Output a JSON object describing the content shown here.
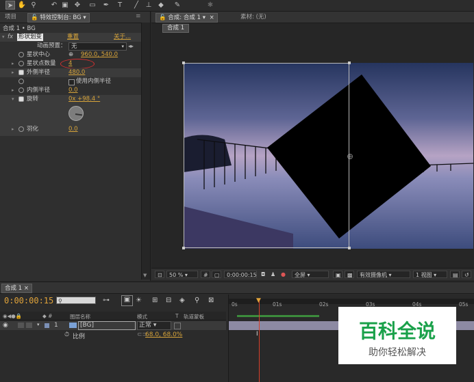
{
  "toolbar": {
    "tools": [
      "selection-tool",
      "hand-tool",
      "zoom-tool",
      "rotate-tool",
      "camera-tool",
      "pan-behind-tool",
      "rectangle-tool",
      "pen-tool",
      "text-tool",
      "brush-tool",
      "clone-stamp-tool",
      "eraser-tool",
      "roto-brush-tool",
      "puppet-tool"
    ]
  },
  "left_panel": {
    "tabs": [
      "项目",
      "特效控制台: BG"
    ],
    "breadcrumb": "合成 1 • BG",
    "effect": {
      "fx_label": "fx",
      "name": "形状划变",
      "reset_label": "重置",
      "about_label": "关于...",
      "animation_preset_label": "动画预置：",
      "animation_preset_value": "无",
      "params": [
        {
          "label": "星状中心",
          "value": "960.0, 540.0"
        },
        {
          "label": "星状点数量",
          "value": "4"
        },
        {
          "label": "外侧半径",
          "value": "480.0"
        },
        {
          "label": "使用内侧半径",
          "value": ""
        },
        {
          "label": "内侧半径",
          "value": "0.0"
        },
        {
          "label": "旋转",
          "value": "0x +98.4 °"
        },
        {
          "label": "羽化",
          "value": "0.0"
        }
      ]
    }
  },
  "viewer": {
    "tabs": [
      "合成: 合成 1",
      "素材: (无)"
    ],
    "comp_button": "合成 1",
    "bottom_bar": {
      "zoom": "50 %",
      "timecode": "0:00:00:15",
      "resolution": "全屏",
      "camera": "有效摄像机",
      "views": "1 视图"
    }
  },
  "timeline": {
    "tab": "合成 1",
    "current_time": "0:00:00:15",
    "search_placeholder": "",
    "columns": {
      "layer_name": "图层名称",
      "mode": "模式",
      "trkmat": "T",
      "track_matte": "轨道蒙板"
    },
    "layer": {
      "number": "1",
      "name": "[BG]",
      "mode": "正常",
      "sub_prop": "比例",
      "sub_value": "68.0, 68.0%"
    },
    "ruler": [
      "0s",
      "01s",
      "02s",
      "03s",
      "04s",
      "05s"
    ]
  },
  "watermark": {
    "title": "百科全说",
    "subtitle": "助你轻松解决"
  },
  "colors": {
    "accent_value": "#d9a53a",
    "highlight_circle": "#d03030",
    "playhead": "#d8402a"
  }
}
